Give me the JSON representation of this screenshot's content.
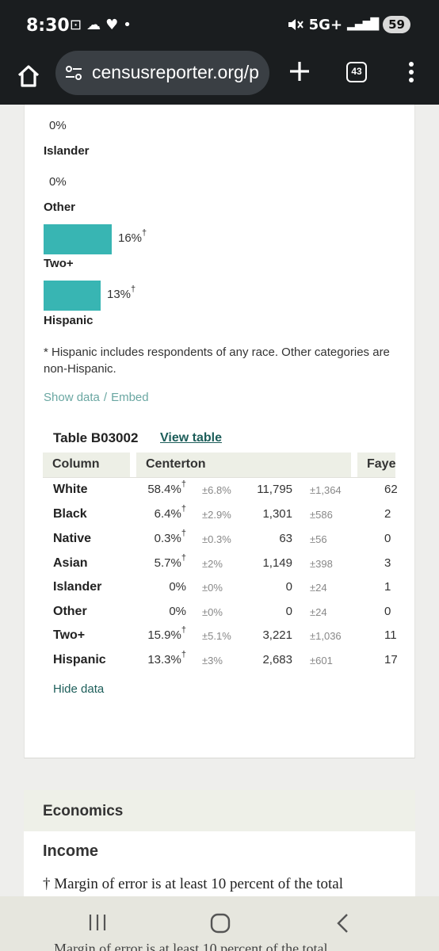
{
  "status_bar": {
    "time": "8:30",
    "left_icons": [
      "screenshot-icon",
      "cloud-icon",
      "heart-icon",
      "dot-icon"
    ],
    "left_glyphs": "⊡☁♥•",
    "network": "5G+",
    "signal": "▂▄▆█",
    "battery": "59"
  },
  "browser": {
    "url": "censusreporter.org/p",
    "tab_count": "43"
  },
  "race_chart": {
    "items": [
      {
        "pct": "0%",
        "label": "Islander",
        "value": 0
      },
      {
        "pct": "0%",
        "label": "Other",
        "value": 0
      },
      {
        "pct": "16%",
        "label": "Two+",
        "value": 16
      },
      {
        "pct": "13%",
        "label": "Hispanic",
        "value": 13
      }
    ],
    "partial_top_pct": "0%",
    "dagger": "†"
  },
  "note": "* Hispanic includes respondents of any race. Other categories are non-Hispanic.",
  "links": {
    "show_data": "Show data",
    "sep": "/",
    "embed": "Embed"
  },
  "table": {
    "title": "Table B03002",
    "view_table": "View table",
    "headers": {
      "column": "Column",
      "place1": "Centerton",
      "place2": "Fayet"
    },
    "rows": [
      {
        "label": "White",
        "pct": "58.4%",
        "pct_moe": "±6.8%",
        "count": "11,795",
        "count_moe": "±1,364",
        "fay": "62",
        "dagger": "†"
      },
      {
        "label": "Black",
        "pct": "6.4%",
        "pct_moe": "±2.9%",
        "count": "1,301",
        "count_moe": "±586",
        "fay": "2",
        "dagger": "†"
      },
      {
        "label": "Native",
        "pct": "0.3%",
        "pct_moe": "±0.3%",
        "count": "63",
        "count_moe": "±56",
        "fay": "0",
        "dagger": "†"
      },
      {
        "label": "Asian",
        "pct": "5.7%",
        "pct_moe": "±2%",
        "count": "1,149",
        "count_moe": "±398",
        "fay": "3",
        "dagger": "†"
      },
      {
        "label": "Islander",
        "pct": "0%",
        "pct_moe": "±0%",
        "count": "0",
        "count_moe": "±24",
        "fay": "1",
        "dagger": ""
      },
      {
        "label": "Other",
        "pct": "0%",
        "pct_moe": "±0%",
        "count": "0",
        "count_moe": "±24",
        "fay": "0",
        "dagger": ""
      },
      {
        "label": "Two+",
        "pct": "15.9%",
        "pct_moe": "±5.1%",
        "count": "3,221",
        "count_moe": "±1,036",
        "fay": "11",
        "dagger": "†"
      },
      {
        "label": "Hispanic",
        "pct": "13.3%",
        "pct_moe": "±3%",
        "count": "2,683",
        "count_moe": "±601",
        "fay": "17",
        "dagger": "†"
      }
    ],
    "hide_data": "Hide data"
  },
  "economics": {
    "section_title": "Economics",
    "subsection": "Income",
    "moe_note": "† Margin of error is at least 10 percent of the total",
    "ghost_text": "Margin of error is at least 10 percent of the total"
  },
  "colors": {
    "bar": "#38b5b3",
    "link": "#6aa7a2",
    "dark_link": "#1d5e5a",
    "chrome": "#1a1d1f"
  }
}
